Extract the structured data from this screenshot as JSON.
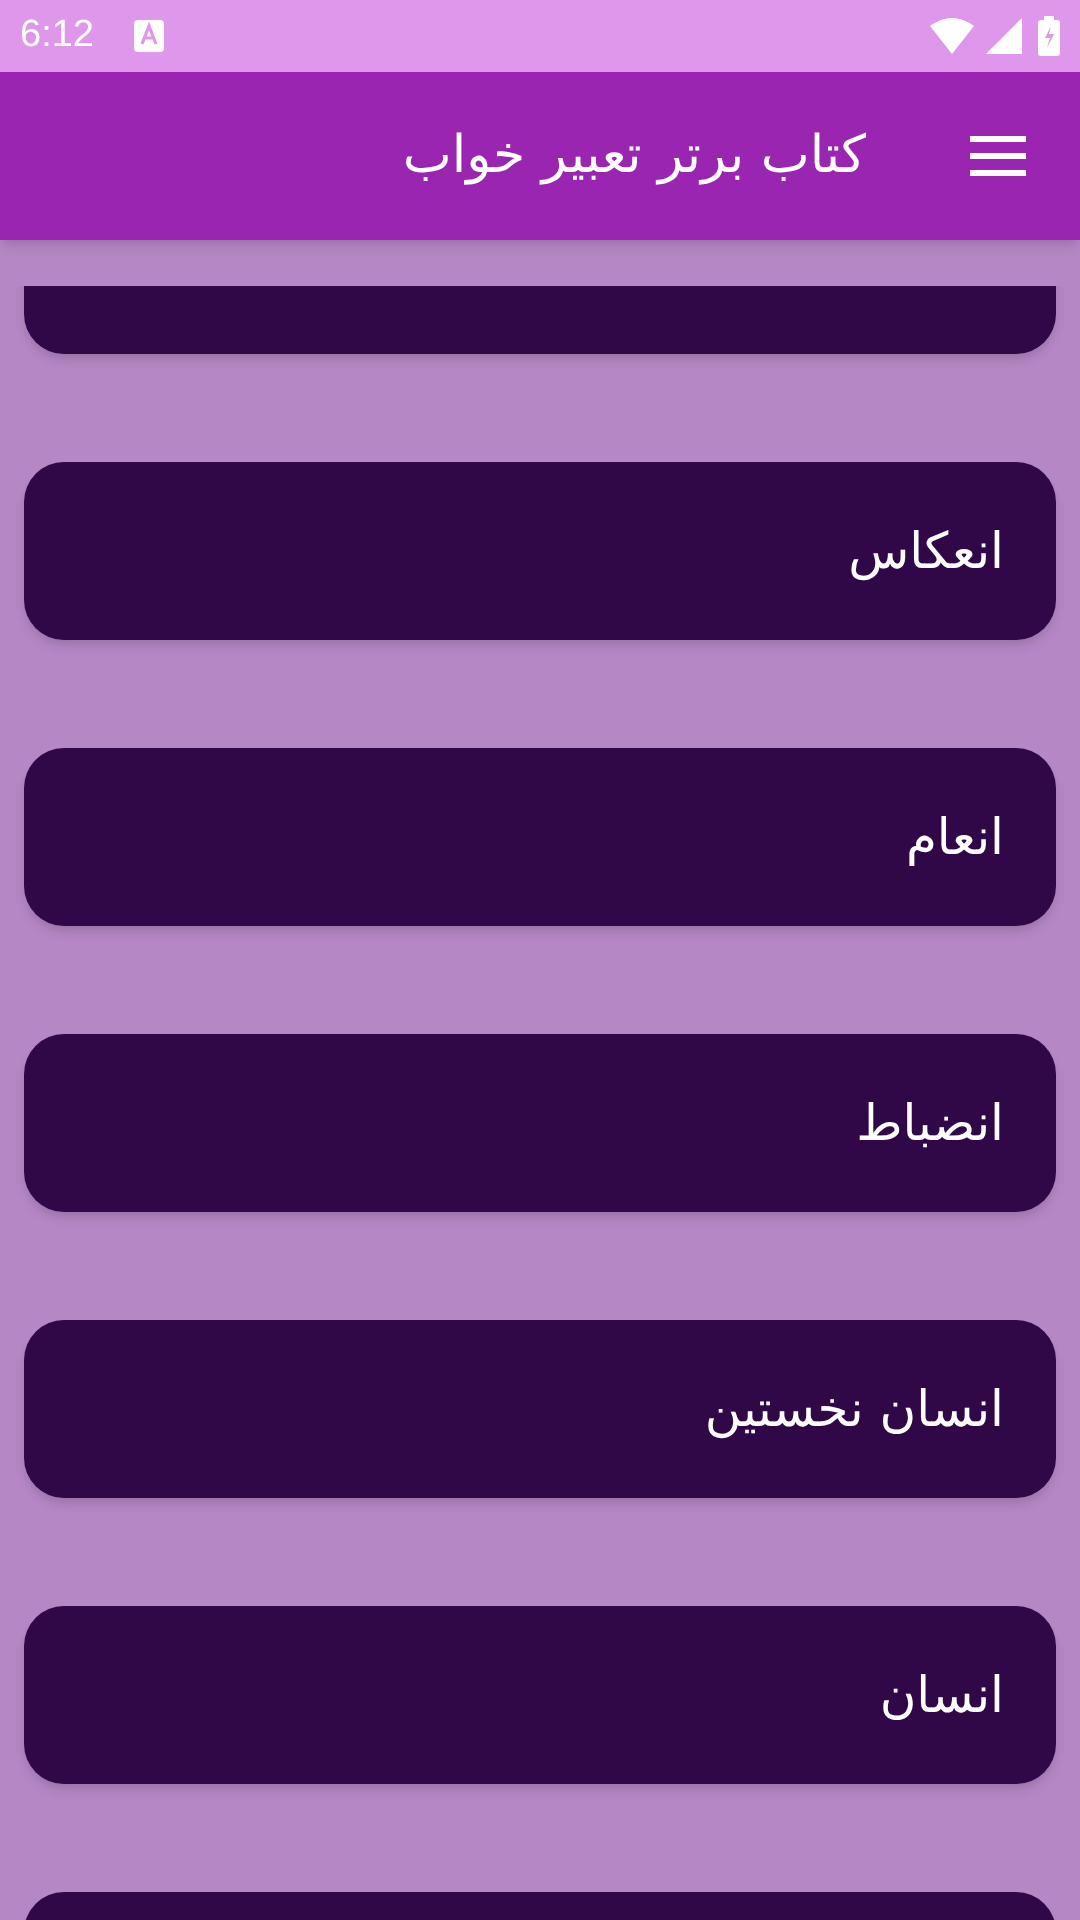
{
  "status_bar": {
    "time": "6:12"
  },
  "app_bar": {
    "title": "کتاب برتر تعبیر خواب"
  },
  "items": [
    {
      "label": "انعکاس"
    },
    {
      "label": "انعام"
    },
    {
      "label": "انضباط"
    },
    {
      "label": "انسان نخستین"
    },
    {
      "label": "انسان"
    }
  ]
}
